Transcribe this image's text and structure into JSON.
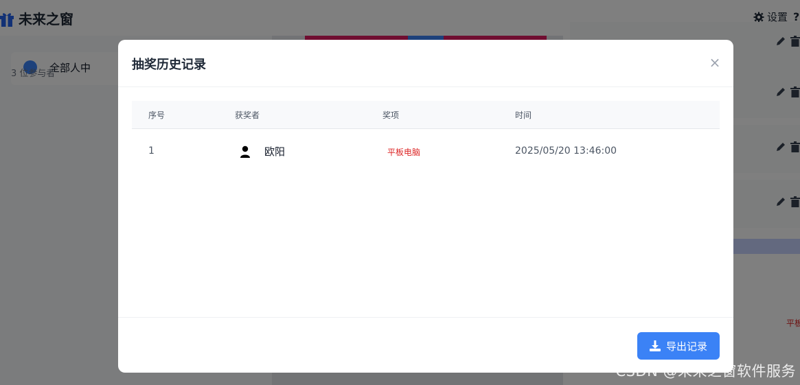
{
  "app": {
    "logo_text": "未来之窗",
    "settings_label": "设置",
    "help_glyph": "?"
  },
  "left_panel": {
    "card_name": "全部人中",
    "participant_count": "3 位参与者"
  },
  "right_panel": {
    "peek_text": "平板"
  },
  "modal": {
    "title": "抽奖历史记录",
    "close_glyph": "×",
    "columns": {
      "index": "序号",
      "winner": "获奖者",
      "prize": "奖项",
      "time": "时间"
    },
    "rows": [
      {
        "index": "1",
        "winner": "欧阳",
        "prize": "平板电脑",
        "time": "2025/05/20 13:46:00"
      }
    ],
    "export_label": "导出记录"
  },
  "watermark": "CSDN @未来之窗软件服务",
  "colors": {
    "accent": "#3b82f6",
    "prize_text": "#dc2626",
    "overlay": "rgba(0,0,0,0.5)"
  },
  "icons": {
    "logo": "gift-icon",
    "settings": "gear-icon",
    "close": "close-icon",
    "winner": "user-icon",
    "export": "download-icon",
    "edit": "pencil-icon",
    "delete": "trash-icon"
  }
}
